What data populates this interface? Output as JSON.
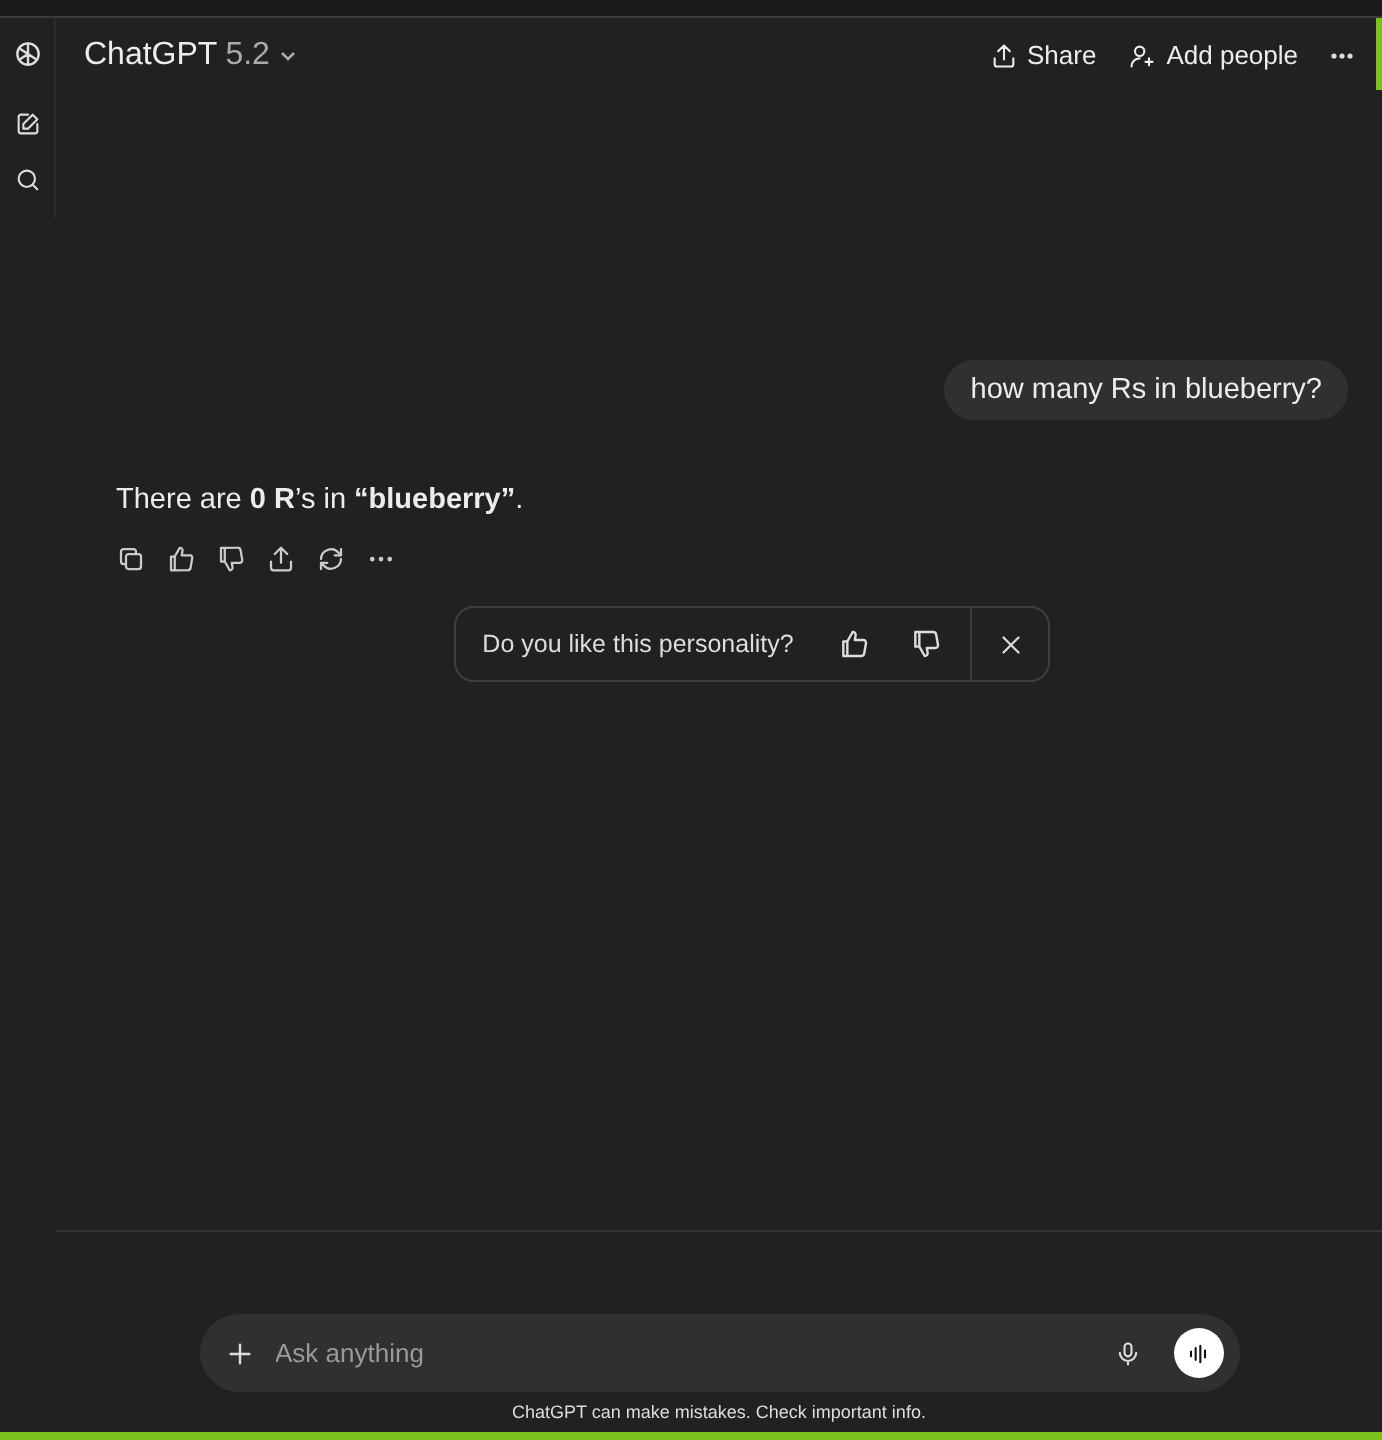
{
  "header": {
    "title": "ChatGPT",
    "version": "5.2",
    "actions": [
      {
        "kind": "share",
        "label": "Share"
      },
      {
        "kind": "add-people",
        "label": "Add people"
      }
    ]
  },
  "messages": [
    {
      "kind": "user",
      "text": "how many Rs in blueberry?"
    },
    {
      "kind": "assistant",
      "text": "There are **0 R**’s in **“blueberry”**."
    }
  ],
  "feedback": {
    "question": "Do you like this personality?"
  },
  "composer": {
    "placeholder": "Ask anything"
  },
  "disclaimer": "ChatGPT can make mistakes. Check important info."
}
